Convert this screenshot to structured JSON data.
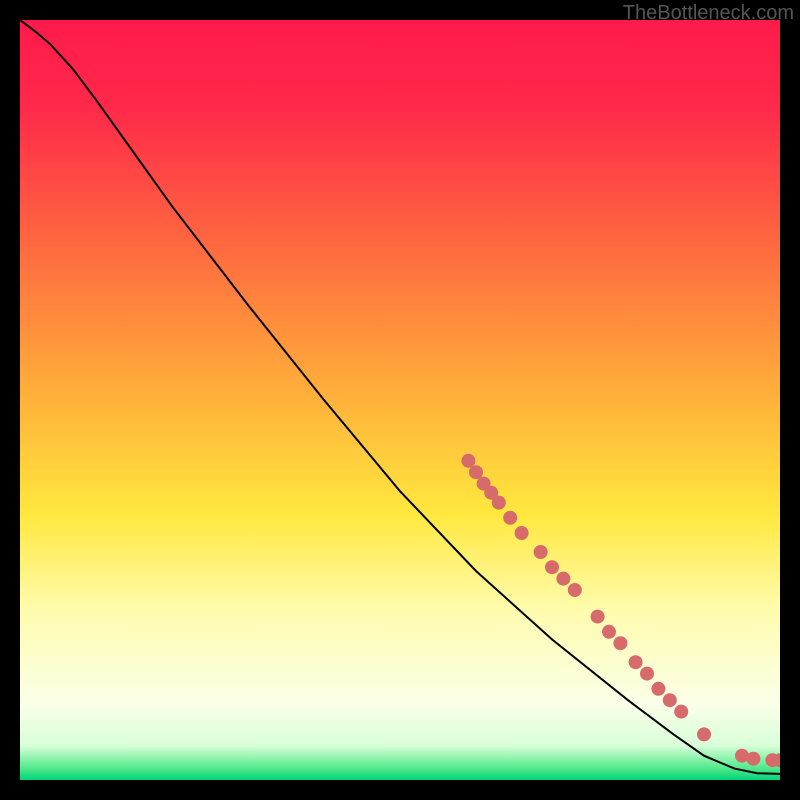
{
  "watermark": "TheBottleneck.com",
  "chart_data": {
    "type": "line",
    "title": "",
    "xlabel": "",
    "ylabel": "",
    "xlim": [
      0,
      100
    ],
    "ylim": [
      0,
      100
    ],
    "gradient_stops": [
      {
        "offset": 0.0,
        "color": "#ff1a4b"
      },
      {
        "offset": 0.12,
        "color": "#ff2a4a"
      },
      {
        "offset": 0.3,
        "color": "#ff6a3f"
      },
      {
        "offset": 0.5,
        "color": "#ffb23a"
      },
      {
        "offset": 0.65,
        "color": "#ffe83e"
      },
      {
        "offset": 0.78,
        "color": "#fffcb0"
      },
      {
        "offset": 0.9,
        "color": "#fbffe8"
      },
      {
        "offset": 0.955,
        "color": "#d8ffd8"
      },
      {
        "offset": 0.985,
        "color": "#4fe98a"
      },
      {
        "offset": 1.0,
        "color": "#00d47a"
      }
    ],
    "series": [
      {
        "name": "curve",
        "kind": "line",
        "color": "#000000",
        "points": [
          {
            "x": 0.0,
            "y": 100.0
          },
          {
            "x": 2.0,
            "y": 98.5
          },
          {
            "x": 4.0,
            "y": 96.8
          },
          {
            "x": 7.0,
            "y": 93.5
          },
          {
            "x": 10.0,
            "y": 89.5
          },
          {
            "x": 15.0,
            "y": 82.5
          },
          {
            "x": 20.0,
            "y": 75.5
          },
          {
            "x": 30.0,
            "y": 62.5
          },
          {
            "x": 40.0,
            "y": 50.0
          },
          {
            "x": 50.0,
            "y": 38.0
          },
          {
            "x": 60.0,
            "y": 27.5
          },
          {
            "x": 70.0,
            "y": 18.5
          },
          {
            "x": 80.0,
            "y": 10.5
          },
          {
            "x": 86.0,
            "y": 6.0
          },
          {
            "x": 90.0,
            "y": 3.2
          },
          {
            "x": 94.0,
            "y": 1.5
          },
          {
            "x": 97.0,
            "y": 0.9
          },
          {
            "x": 100.0,
            "y": 0.8
          }
        ]
      },
      {
        "name": "markers",
        "kind": "scatter",
        "color": "#d76a6a",
        "radius_px": 7,
        "points": [
          {
            "x": 59.0,
            "y": 42.0
          },
          {
            "x": 60.0,
            "y": 40.5
          },
          {
            "x": 61.0,
            "y": 39.0
          },
          {
            "x": 62.0,
            "y": 37.8
          },
          {
            "x": 63.0,
            "y": 36.5
          },
          {
            "x": 64.5,
            "y": 34.5
          },
          {
            "x": 66.0,
            "y": 32.5
          },
          {
            "x": 68.5,
            "y": 30.0
          },
          {
            "x": 70.0,
            "y": 28.0
          },
          {
            "x": 71.5,
            "y": 26.5
          },
          {
            "x": 73.0,
            "y": 25.0
          },
          {
            "x": 76.0,
            "y": 21.5
          },
          {
            "x": 77.5,
            "y": 19.5
          },
          {
            "x": 79.0,
            "y": 18.0
          },
          {
            "x": 81.0,
            "y": 15.5
          },
          {
            "x": 82.5,
            "y": 14.0
          },
          {
            "x": 84.0,
            "y": 12.0
          },
          {
            "x": 85.5,
            "y": 10.5
          },
          {
            "x": 87.0,
            "y": 9.0
          },
          {
            "x": 90.0,
            "y": 6.0
          },
          {
            "x": 95.0,
            "y": 3.2
          },
          {
            "x": 96.5,
            "y": 2.8
          },
          {
            "x": 99.0,
            "y": 2.6
          },
          {
            "x": 100.0,
            "y": 2.6
          }
        ]
      }
    ]
  }
}
